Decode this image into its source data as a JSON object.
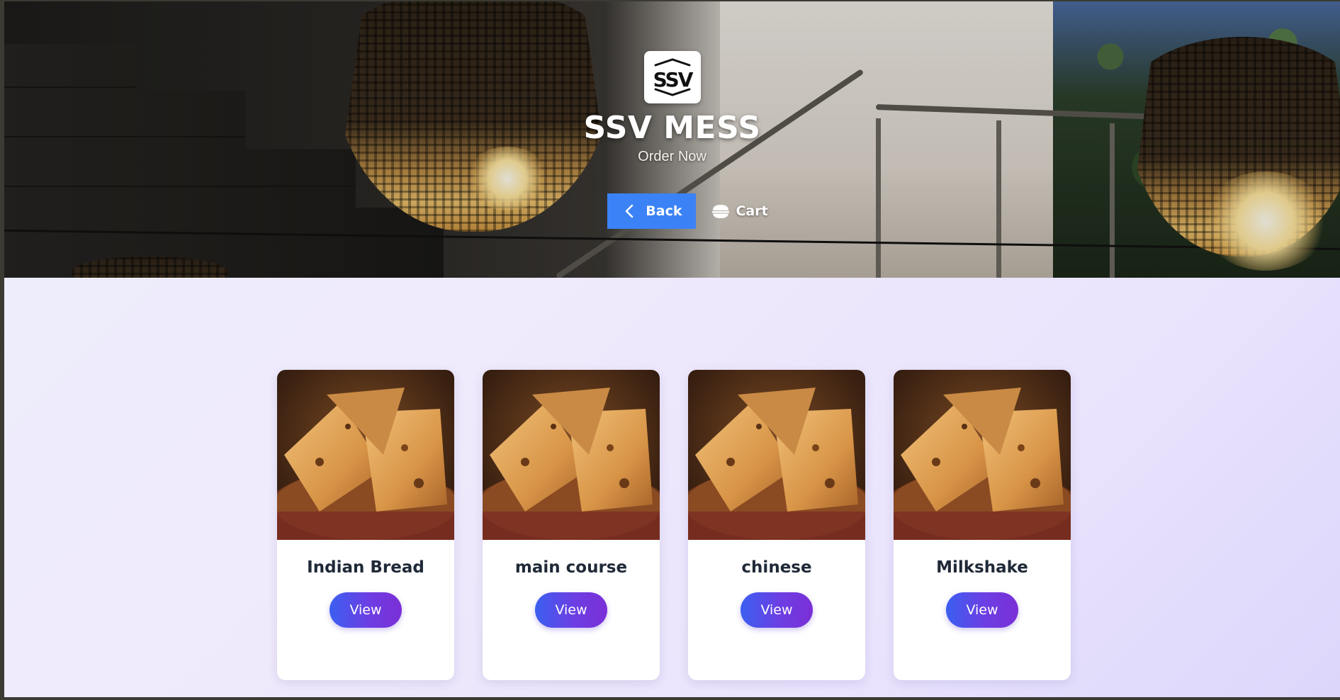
{
  "header": {
    "logo_text": "SSV",
    "title": "SSV MESS",
    "subtitle": "Order Now",
    "back_label": "Back",
    "cart_label": "Cart"
  },
  "categories": [
    {
      "name": "Indian Bread",
      "button": "View"
    },
    {
      "name": "main course",
      "button": "View"
    },
    {
      "name": "chinese",
      "button": "View"
    },
    {
      "name": "Milkshake",
      "button": "View"
    }
  ],
  "colors": {
    "accent_blue": "#3b82f6",
    "view_gradient_start": "#3b5ff0",
    "view_gradient_end": "#7a2fd6",
    "title_text": "#1f2937"
  },
  "icons": {
    "back": "chevron-left-icon",
    "cart": "bowl-icon"
  }
}
